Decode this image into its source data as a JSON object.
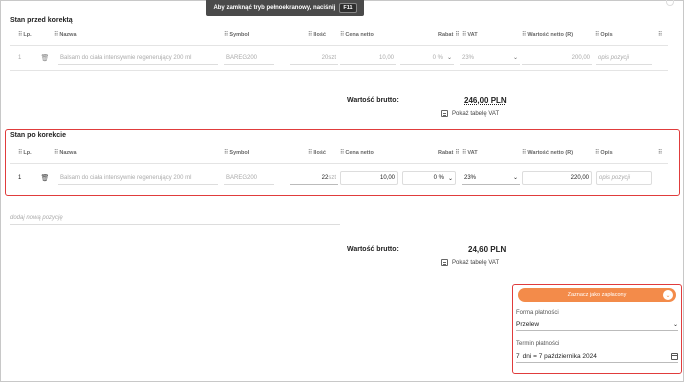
{
  "banner": {
    "text": "Aby zamknąć tryb pełnoekranowy, naciśnij",
    "key": "F11"
  },
  "before": {
    "title": "Stan przed korektą",
    "columns": [
      "Lp.",
      "Nazwa",
      "Symbol",
      "Ilość",
      "Cena netto",
      "Rabat",
      "VAT",
      "Wartość netto (R)",
      "Opis"
    ],
    "row": {
      "lp": "1",
      "name": "Balsam do ciała intensywnie regenerujący 200 ml",
      "symbol": "BAREG200",
      "qty": "20",
      "unit": "szt",
      "price": "10,00",
      "discount": "0 %",
      "vat": "23%",
      "net": "200,00",
      "desc_placeholder": "opis pozycji"
    },
    "gross_label": "Wartość brutto:",
    "gross_value": "246,00 PLN",
    "vat_table_link": "Pokaż tabelę VAT"
  },
  "after": {
    "title": "Stan po korekcie",
    "columns": [
      "Lp.",
      "Nazwa",
      "Symbol",
      "Ilość",
      "Cena netto",
      "Rabat",
      "VAT",
      "Wartość netto (R)",
      "Opis"
    ],
    "row": {
      "lp": "1",
      "name": "Balsam do ciała intensywnie regenerujący 200 ml",
      "symbol": "BAREG200",
      "qty": "22",
      "unit": "szt",
      "price": "10,00",
      "discount": "0 %",
      "vat": "23%",
      "net": "220,00",
      "desc_placeholder": "opis pozycji"
    },
    "add_position_placeholder": "dodaj nową pozycję",
    "gross_label": "Wartość brutto:",
    "gross_value": "24,60 PLN",
    "vat_table_link": "Pokaż tabelę VAT"
  },
  "payment": {
    "mark_paid_label": "Zaznacz jako zapłacony",
    "method_label": "Forma płatności",
    "method_value": "Przelew",
    "due_label": "Termin płatności",
    "due_days": "7",
    "due_text": "dni = 7 października 2024"
  },
  "colors": {
    "accent": "#f38b4a",
    "highlight": "#e03c3c"
  },
  "icons": [
    "drag-grip-icon",
    "trash-icon",
    "chevron-down-icon",
    "table-icon",
    "calendar-icon"
  ]
}
